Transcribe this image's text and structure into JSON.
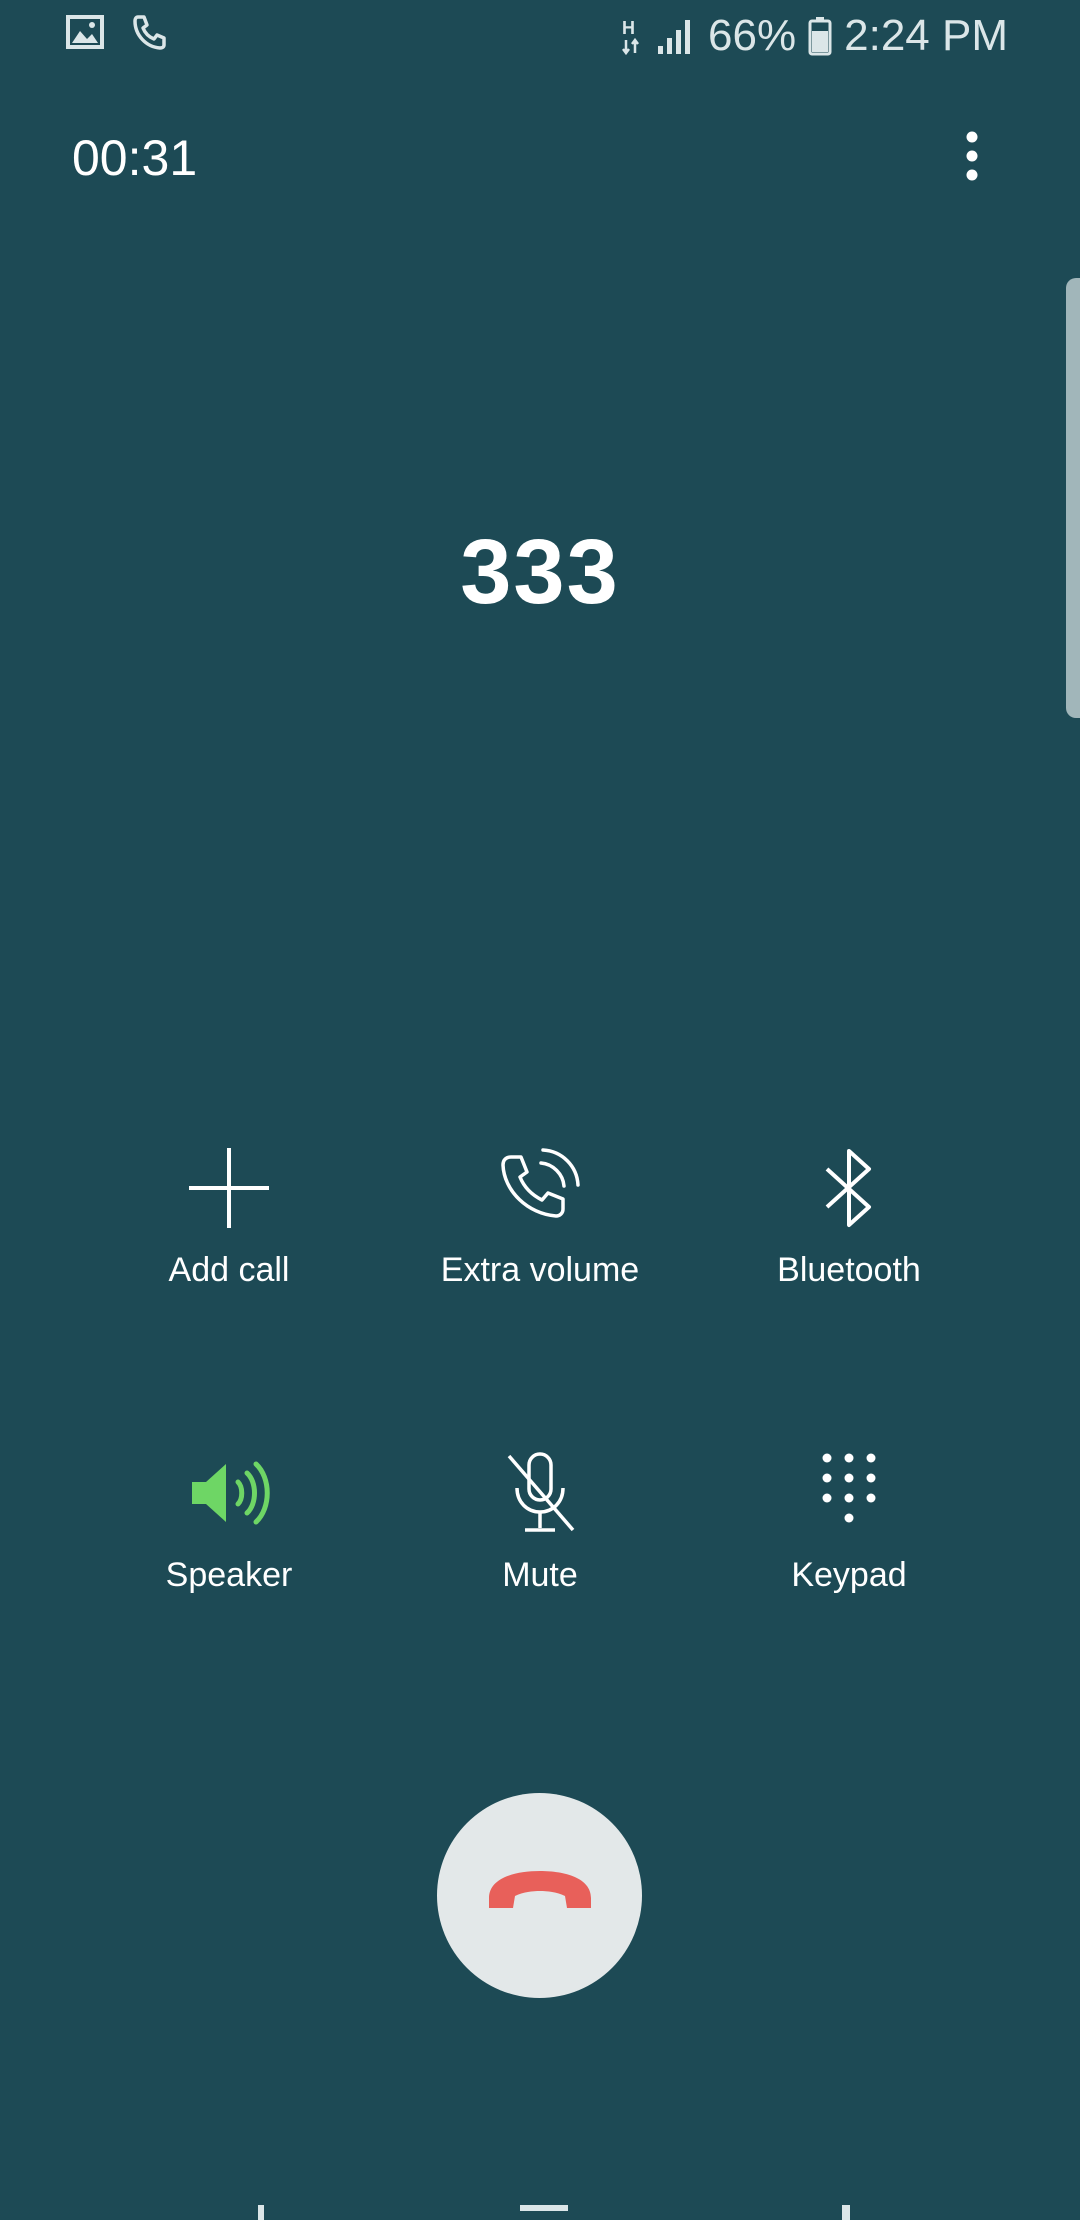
{
  "status_bar": {
    "left_icons": [
      "image-icon",
      "phone-icon"
    ],
    "network": "H",
    "battery": "66%",
    "time": "2:24 PM"
  },
  "call": {
    "duration": "00:31",
    "number": "333"
  },
  "controls": [
    {
      "label": "Add call",
      "icon": "plus-icon"
    },
    {
      "label": "Extra volume",
      "icon": "extra-volume-icon"
    },
    {
      "label": "Bluetooth",
      "icon": "bluetooth-icon"
    },
    {
      "label": "Speaker",
      "icon": "speaker-icon"
    },
    {
      "label": "Mute",
      "icon": "mute-icon"
    },
    {
      "label": "Keypad",
      "icon": "keypad-icon"
    }
  ],
  "colors": {
    "background": "#1d4a55",
    "speaker_active": "#6ed665",
    "end_call_button": "#e3e8e9",
    "end_call_icon": "#e8605a"
  },
  "end_call": {
    "icon": "end-call-icon"
  },
  "menu": {
    "icon": "more-vert-icon"
  }
}
